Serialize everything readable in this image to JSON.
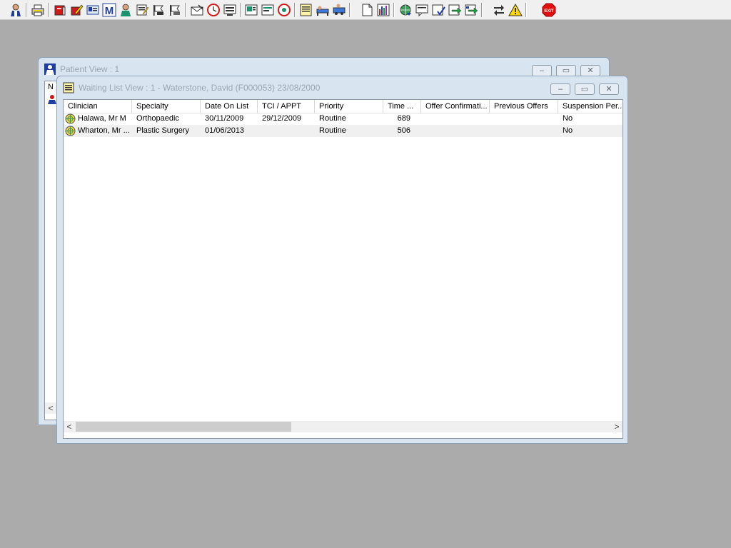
{
  "toolbar": {
    "icons": [
      "patient-search-icon",
      "printer-icon",
      "book-red-icon",
      "book-edit-icon",
      "patient-card-icon",
      "letter-m-icon",
      "clinician-icon",
      "notes-icon",
      "flag-icon",
      "flag-alt-icon",
      "envelope-open-icon",
      "clock-icon",
      "monitor-icon",
      "picture-icon",
      "form-icon",
      "disc-icon",
      "list-yellow-icon",
      "bed-icon",
      "transport-icon",
      "document-icon",
      "bar-chart-icon",
      "globe-arrow-icon",
      "message-icon",
      "check-form-icon",
      "refer-icon",
      "refer-alt-icon",
      "transfer-icon",
      "warning-icon",
      "exit-icon"
    ],
    "exit_label": "EXIT"
  },
  "patient_view": {
    "title": "Patient View : 1",
    "partial_header": "N",
    "minimize": "–",
    "maximize": "▭",
    "close": "✕"
  },
  "waiting_list_view": {
    "title": "Waiting List View :  1 - Waterstone, David (F000053) 23/08/2000",
    "minimize": "–",
    "maximize": "▭",
    "close": "✕",
    "columns": [
      "Clinician",
      "Specialty",
      "Date On List",
      "TCI / APPT",
      "Priority",
      "Time ...",
      "Offer Confirmati...",
      "Previous Offers",
      "Suspension Per..."
    ],
    "rows": [
      {
        "clinician": "Halawa, Mr M",
        "specialty": "Orthopaedic",
        "date_on_list": "30/11/2009",
        "tci_appt": "29/12/2009",
        "priority": "Routine",
        "time": "689",
        "offer_confirmation": "",
        "previous_offers": "",
        "suspension": "No"
      },
      {
        "clinician": "Wharton, Mr ...",
        "specialty": "Plastic Surgery",
        "date_on_list": "01/06/2013",
        "tci_appt": "",
        "priority": "Routine",
        "time": "506",
        "offer_confirmation": "",
        "previous_offers": "",
        "suspension": "No"
      }
    ],
    "scroll_left": "<",
    "scroll_right": ">"
  },
  "colors": {
    "desktop": "#ababab",
    "toolbar": "#f0f0f0",
    "window_frame": "#d8e4f0",
    "title_text_inactive": "#9aa6b2",
    "row_alt": "#f0f0f0",
    "exit_red": "#e01010"
  }
}
